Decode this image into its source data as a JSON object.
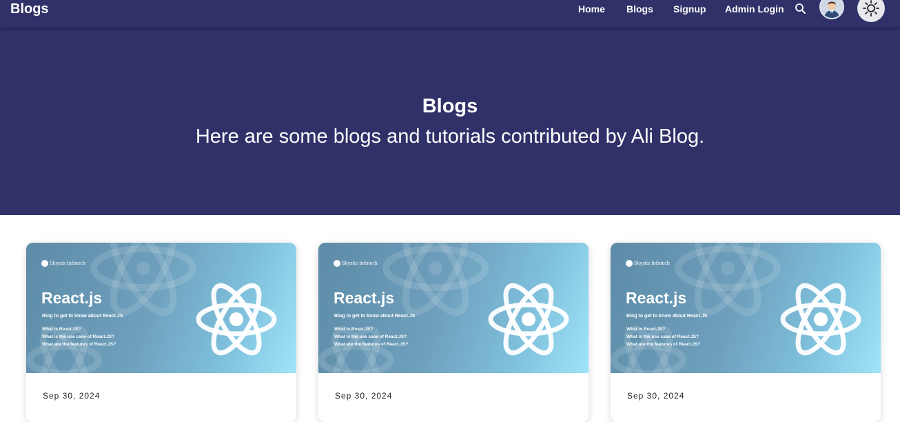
{
  "nav": {
    "brand": "Blogs",
    "links": [
      {
        "label": "Home"
      },
      {
        "label": "Blogs"
      },
      {
        "label": "Signup"
      },
      {
        "label": "Admin Login"
      }
    ],
    "icons": {
      "search": "search-icon",
      "avatar": "user-avatar",
      "theme": "sun-icon"
    }
  },
  "hero": {
    "title": "Blogs",
    "subtitle": "Here are some blogs and tutorials contributed by Ali Blog."
  },
  "colors": {
    "nav_bg": "#31316a",
    "hero_bg": "#31316a",
    "card_image_start": "#5d8ba8",
    "card_image_end": "#9fe4f8"
  },
  "cards": [
    {
      "image": {
        "brand": "Skystis Infotech",
        "heading": "React.js",
        "tagline": "Blog to get to know about React.JS",
        "questions": [
          "What is React.JS?",
          "What is the use case of React.JS?",
          "What are the features of React.JS?"
        ]
      },
      "date": "Sep 30, 2024"
    },
    {
      "image": {
        "brand": "Skystis Infotech",
        "heading": "React.js",
        "tagline": "Blog to get to know about React.JS",
        "questions": [
          "What is React.JS?",
          "What is the use case of React.JS?",
          "What are the features of React.JS?"
        ]
      },
      "date": "Sep 30, 2024"
    },
    {
      "image": {
        "brand": "Skystis Infotech",
        "heading": "React.js",
        "tagline": "Blog to get to know about React.JS",
        "questions": [
          "What is React.JS?",
          "What is the use case of React.JS?",
          "What are the features of React.JS?"
        ]
      },
      "date": "Sep 30, 2024"
    }
  ]
}
